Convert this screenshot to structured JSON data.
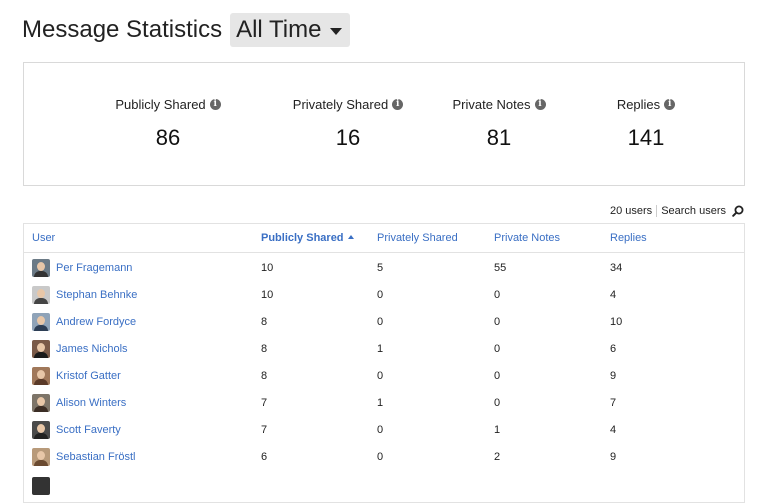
{
  "header": {
    "title": "Message Statistics",
    "range": "All Time"
  },
  "stats": [
    {
      "label": "Publicly Shared",
      "value": "86"
    },
    {
      "label": "Privately Shared",
      "value": "16"
    },
    {
      "label": "Private Notes",
      "value": "81"
    },
    {
      "label": "Replies",
      "value": "141"
    }
  ],
  "table_tools": {
    "count": "20 users",
    "search": "Search users"
  },
  "table": {
    "columns": [
      "User",
      "Publicly Shared",
      "Privately Shared",
      "Private Notes",
      "Replies"
    ],
    "sorted_column": "Publicly Shared",
    "rows": [
      {
        "user": "Per Fragemann",
        "public": "10",
        "private": "5",
        "notes": "55",
        "replies": "34"
      },
      {
        "user": "Stephan Behnke",
        "public": "10",
        "private": "0",
        "notes": "0",
        "replies": "4"
      },
      {
        "user": "Andrew Fordyce",
        "public": "8",
        "private": "0",
        "notes": "0",
        "replies": "10"
      },
      {
        "user": "James Nichols",
        "public": "8",
        "private": "1",
        "notes": "0",
        "replies": "6"
      },
      {
        "user": "Kristof Gatter",
        "public": "8",
        "private": "0",
        "notes": "0",
        "replies": "9"
      },
      {
        "user": "Alison Winters",
        "public": "7",
        "private": "1",
        "notes": "0",
        "replies": "7"
      },
      {
        "user": "Scott Faverty",
        "public": "7",
        "private": "0",
        "notes": "1",
        "replies": "4"
      },
      {
        "user": "Sebastian Fröstl",
        "public": "6",
        "private": "0",
        "notes": "2",
        "replies": "9"
      }
    ]
  },
  "colors": {
    "link": "#3a6fc4",
    "border": "#d9d9d9",
    "select_bg": "#e6e6e6"
  }
}
